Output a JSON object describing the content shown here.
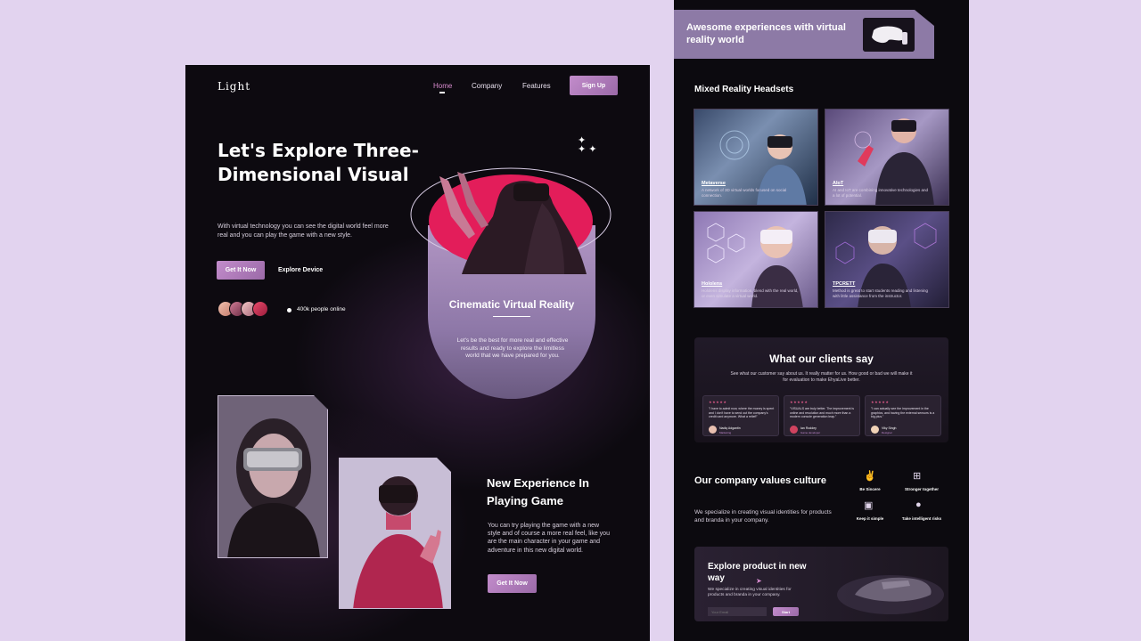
{
  "left": {
    "logo": "Light",
    "nav": [
      "Home",
      "Company",
      "Features"
    ],
    "signup_label": "Sign Up",
    "hero": {
      "title": "Let's Explore Three-Dimensional Visual",
      "description": "With virtual technology you can see the digital world feel more real and you can play the game with a new style.",
      "primary_button": "Get It Now",
      "secondary_link": "Explore Device",
      "online_count": "400k people online"
    },
    "capsule": {
      "title": "Cinematic Virtual Reality",
      "description": "Let's be the best for more real and effective results and ready to explore the limitless world that we have prepared for you."
    },
    "game": {
      "title": "New Experience In Playing Game",
      "description": "You can try playing the game with a new style and of course a more real feel, like you are the main character in your game and adventure in this new digital world.",
      "button": "Get It Now"
    }
  },
  "right": {
    "banner": "Awesome experiences with virtual reality world",
    "headsets_title": "Mixed Reality Headsets",
    "cards": [
      {
        "label": "Metaverse",
        "desc": "A network of 3D virtual worlds focused on social connection."
      },
      {
        "label": "AIoT",
        "desc": "AI and IoT are combining innovative technologies and a lot of potential."
      },
      {
        "label": "Hololens",
        "desc": "Hololens display information, blend with the real world, or even simulate a virtual world."
      },
      {
        "label": "TPCRETT",
        "desc": "Method is great to start students reading and listening with little assistance from the instructor."
      }
    ],
    "testimonials": {
      "title": "What our clients say",
      "subtitle": "See what our customer say about us. It really matter for us. How good or bad we will make it for evaluation to make EhyaLive better.",
      "items": [
        {
          "stars": "★★★★★",
          "text": "\"I have to admit now, where the money is spent and I don't have to send out the company's credit card anymore. What a relief!\"",
          "name": "Nadiq Adgantin",
          "role": "Marketing"
        },
        {
          "stars": "★★★★★",
          "text": "\"VISUALS are truly better. The improvement is online and resolution and much more than a modern console generation leap.\"",
          "name": "Ian Roddey",
          "role": "Game developer"
        },
        {
          "stars": "★★★★★",
          "text": "\"I can actually see the improvement in the graphics, and having the external sensors is a big plus.\"",
          "name": "Viky Singh",
          "role": "Designer"
        }
      ]
    },
    "values": {
      "title": "Our company values culture",
      "description": "We specialize in creating visual identities for products and branda in your company.",
      "items": [
        "Be Sincere",
        "Stronger together",
        "Keep it simple",
        "Take intelligent risks"
      ]
    },
    "explore": {
      "title": "Explore product in new way",
      "description": "We specialize in creating visual identities for products and branda in your company.",
      "email_placeholder": "Your Email",
      "button": "Start"
    }
  },
  "colors": {
    "accent_pink": "#c28ccb",
    "hot_pink": "#e0235f",
    "lavender_bg": "#e2d3ef",
    "dark_bg": "#0d0a10"
  }
}
